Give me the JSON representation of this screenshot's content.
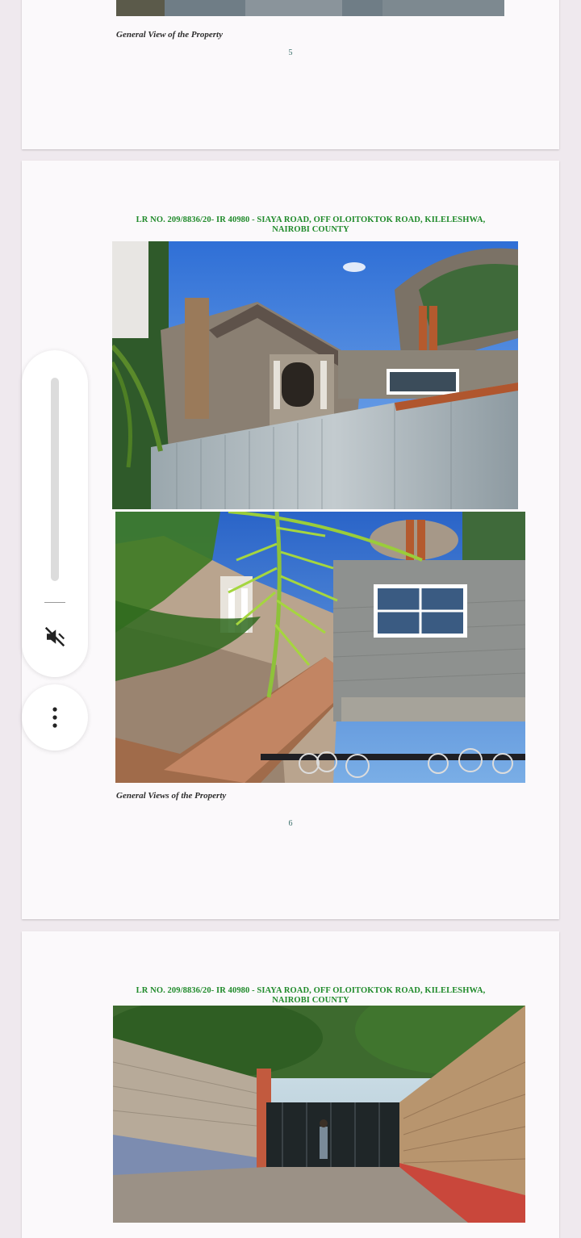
{
  "document": {
    "pages": [
      {
        "caption": "General View of the Property",
        "page_number": "5"
      },
      {
        "header_line1": "LR NO. 209/8836/20- IR 40980 - SIAYA ROAD, OFF OLOITOKTOK ROAD, KILELESHWA,",
        "header_line2": "NAIROBI COUNTY",
        "caption": "General Views of the Property",
        "page_number": "6"
      },
      {
        "header_line1": "LR NO. 209/8836/20- IR 40980 - SIAYA ROAD, OFF OLOITOKTOK ROAD, KILELESHWA,",
        "header_line2": "NAIROBI COUNTY"
      }
    ]
  },
  "volume_panel": {
    "level": 0,
    "muted": true,
    "mute_icon": "volume-off-icon",
    "more_icon": "more-vert-icon"
  },
  "colors": {
    "header_green": "#1f8a2a",
    "page_bg": "#fbf9fb",
    "viewer_bg": "#efe9ee"
  }
}
